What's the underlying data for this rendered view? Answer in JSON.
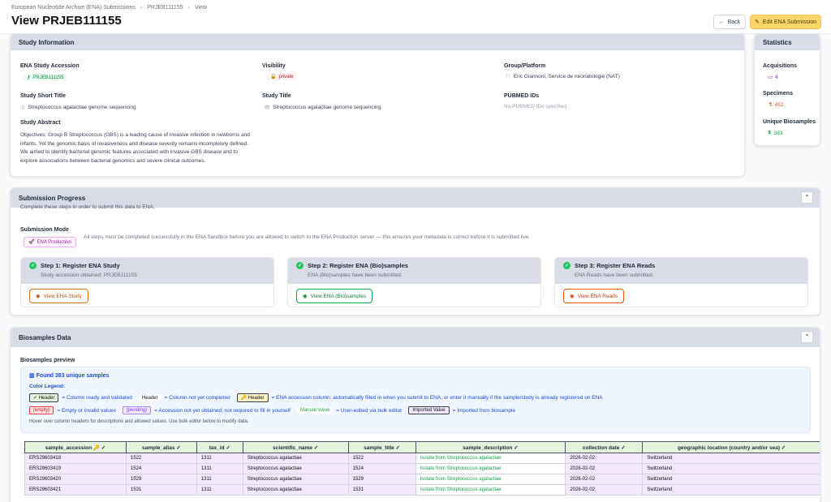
{
  "breadcrumb": [
    "European Nucleotide Archive (ENA) Submissions",
    "PRJEB111155",
    "View"
  ],
  "page_title": "View PRJEB111155",
  "buttons": {
    "back": "Back",
    "edit": "Edit ENA Submission"
  },
  "study": {
    "header": "Study Information",
    "accession_label": "ENA Study Accession",
    "accession": "PRJEB111155",
    "visibility_label": "Visibility",
    "visibility": "private",
    "group_label": "Group/Platform",
    "group": "Eric Giannoni, Service de néonatologie (NAT)",
    "short_title_label": "Study Short Title",
    "short_title": "Streptococcus agalactiae genome sequencing",
    "title_label": "Study Title",
    "title": "Streptococcus agalactiae genome sequencing",
    "pubmed_label": "PUBMED IDs",
    "pubmed": "No PUBMED IDs specified",
    "abstract_label": "Study Abstract",
    "abstract": "Objectives: Group B Streptococcus (GBS) is a leading cause of invasive infection in newborns and infants. Yet the genomic basis of invasiveness and disease severity remains incompletely defined. We aimed to identify bacterial genomic features associated with invasive GBS disease and to explore associations between bacterial genomics and severe clinical outcomes."
  },
  "stats": {
    "header": "Statistics",
    "acq_label": "Acquisitions",
    "acq": "4",
    "spec_label": "Specimens",
    "spec": "452",
    "bio_label": "Unique Biosamples",
    "bio": "383"
  },
  "progress": {
    "header": "Submission Progress",
    "subtitle": "Complete these steps in order to submit this data to ENA.",
    "mode_label": "Submission Mode",
    "mode": "ENA Production",
    "mode_note": "All steps must be completed successfully in the ENA Sandbox before you are allowed to switch to the ENA Production server — this ensures your metadata is correct before it is submitted live.",
    "steps": [
      {
        "title": "Step 1: Register ENA Study",
        "sub": "Study accession obtained: PRJEB111155",
        "button": "View ENA Study",
        "color": "#d97706"
      },
      {
        "title": "Step 2: Register ENA (Bio)samples",
        "sub": "ENA (Bio)samples have been submitted.",
        "button": "View ENA (Bio)samples",
        "color": "#16a34a"
      },
      {
        "title": "Step 3: Register ENA Reads",
        "sub": "ENA Reads have been submitted.",
        "button": "View ENA Reads",
        "color": "#ea580c"
      }
    ]
  },
  "biosamples": {
    "header": "Biosamples Data",
    "preview_label": "Biosamples preview",
    "found": "Found 383 unique samples",
    "legend_title": "Color Legend:",
    "legend": {
      "ready_chip": "✓ Header",
      "ready_text": "= Column ready and validated",
      "notdone_chip": "Header",
      "notdone_text": "= Column not yet completed",
      "acc_chip": "🔑 Header",
      "acc_text": "= ENA accession column: automatically filled in when you submit to ENA, or enter it manually if the sample/study is already registered on ENA",
      "empty_chip": "(empty)",
      "empty_text": "= Empty or invalid values",
      "pending_chip": "(pending)",
      "pending_text": "= Accession not yet obtained; not required to fill in yourself",
      "manual_chip": "Manual Value",
      "manual_text": "= User-edited via bulk editor",
      "imported_chip": "Imported Value",
      "imported_text": "= Imported from biosample",
      "hint": "Hover over column headers for descriptions and allowed values. Use bulk editor below to modify data."
    },
    "columns": [
      "sample_accession 🔑 ✓",
      "sample_alias ✓",
      "tax_id ✓",
      "scientific_name ✓",
      "sample_title ✓",
      "sample_description ✓",
      "collection date ✓",
      "geographic location (country and/or sea) ✓"
    ],
    "rows": [
      [
        "ERS29603418",
        "1522",
        "1311",
        "Streptococcus agalactiae",
        "1522",
        "Isolate from Streptococcus agalactiae",
        "2026-02-02",
        "Switzerland"
      ],
      [
        "ERS29603419",
        "1524",
        "1311",
        "Streptococcus agalactiae",
        "1524",
        "Isolate from Streptococcus agalactiae",
        "2026-02-02",
        "Switzerland"
      ],
      [
        "ERS29603420",
        "1529",
        "1311",
        "Streptococcus agalactiae",
        "1529",
        "Isolate from Streptococcus agalactiae",
        "2026-02-02",
        "Switzerland"
      ],
      [
        "ERS29603421",
        "1531",
        "1311",
        "Streptococcus agalactiae",
        "1531",
        "Isolate from Streptococcus agalactiae",
        "2026-02-02",
        "Switzerland"
      ]
    ]
  }
}
